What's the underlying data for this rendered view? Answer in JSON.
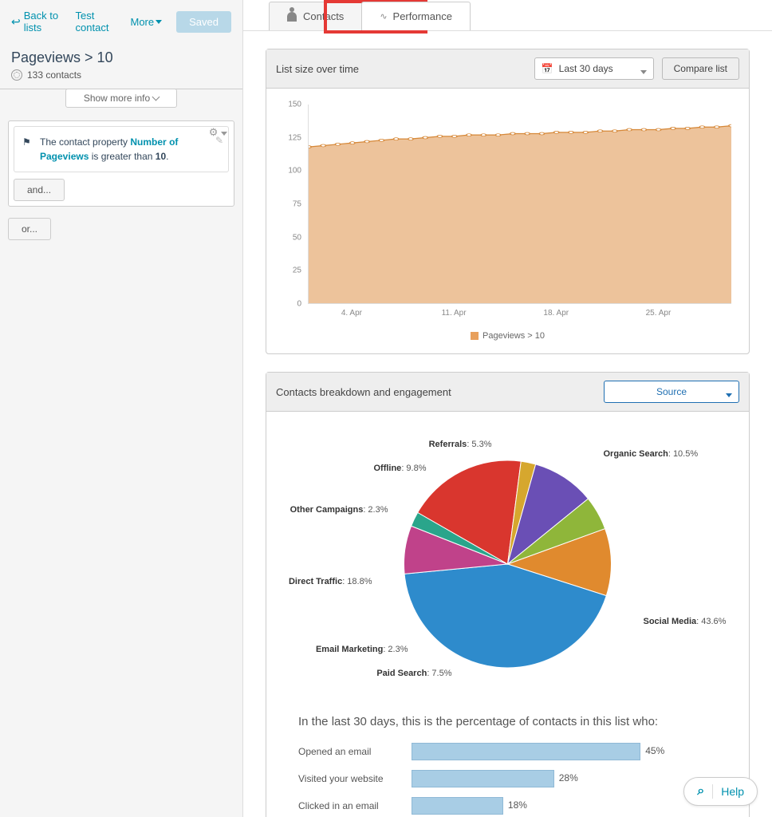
{
  "sidebar": {
    "back_label": "Back to lists",
    "test_contact": "Test contact",
    "more_label": "More",
    "saved_label": "Saved",
    "list_title": "Pageviews > 10",
    "contacts_count": "133 contacts",
    "show_more": "Show more info",
    "filter": {
      "prefix": "The contact property ",
      "property": "Number of Pageviews",
      "mid": " is greater than ",
      "value": "10",
      "suffix": "."
    },
    "and_label": "and...",
    "or_label": "or..."
  },
  "tabs": {
    "contacts": "Contacts",
    "performance": "Performance"
  },
  "panel1": {
    "title": "List size over time",
    "range_label": "Last 30 days",
    "compare_label": "Compare list",
    "legend": "Pageviews > 10"
  },
  "panel2": {
    "title": "Contacts breakdown and engagement",
    "source_label": "Source",
    "engage_title": "In the last 30 days, this is the percentage of contacts in this list who:",
    "rows": [
      {
        "label": "Opened an email",
        "value": 45,
        "text": "45%"
      },
      {
        "label": "Visited your website",
        "value": 28,
        "text": "28%"
      },
      {
        "label": "Clicked in an email",
        "value": 18,
        "text": "18%"
      }
    ]
  },
  "help": {
    "label": "Help"
  },
  "chart_data": [
    {
      "type": "area",
      "title": "List size over time",
      "ylabel": "",
      "ylim": [
        0,
        150
      ],
      "y_ticks": [
        0,
        25,
        50,
        75,
        100,
        125,
        150
      ],
      "x_ticks": [
        "4. Apr",
        "11. Apr",
        "18. Apr",
        "25. Apr"
      ],
      "series": [
        {
          "name": "Pageviews > 10",
          "color": "#e8a05c",
          "values": [
            118,
            119,
            120,
            121,
            122,
            123,
            124,
            124,
            125,
            126,
            126,
            127,
            127,
            127,
            128,
            128,
            128,
            129,
            129,
            129,
            130,
            130,
            131,
            131,
            131,
            132,
            132,
            133,
            133,
            134
          ]
        }
      ]
    },
    {
      "type": "pie",
      "title": "Contacts breakdown and engagement",
      "series": [
        {
          "name": "Social Media",
          "value": 43.6,
          "color": "#2e8bcc"
        },
        {
          "name": "Organic Search",
          "value": 10.5,
          "color": "#e08a2e"
        },
        {
          "name": "Referrals",
          "value": 5.3,
          "color": "#8fb63a"
        },
        {
          "name": "Offline",
          "value": 9.8,
          "color": "#6a4fb5"
        },
        {
          "name": "Other Campaigns",
          "value": 2.3,
          "color": "#d6a72e"
        },
        {
          "name": "Direct Traffic",
          "value": 18.8,
          "color": "#d9362e"
        },
        {
          "name": "Email Marketing",
          "value": 2.3,
          "color": "#2aa58b"
        },
        {
          "name": "Paid Search",
          "value": 7.5,
          "color": "#c0428a"
        }
      ]
    }
  ]
}
